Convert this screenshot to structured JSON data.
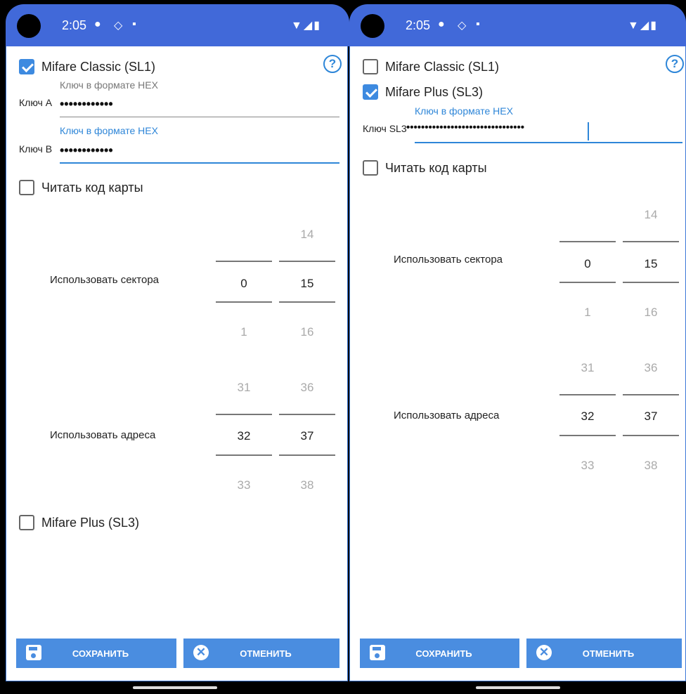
{
  "status_bar": {
    "time": "2:05"
  },
  "left": {
    "mifare_classic": {
      "label": "Mifare Classic (SL1)",
      "checked": true
    },
    "help_glyph": "?",
    "key_a": {
      "hint": "Ключ в формате HEX",
      "label": "Ключ A",
      "value": "••••••••••••"
    },
    "key_b": {
      "hint": "Ключ в формате HEX",
      "label": "Ключ B",
      "value": "••••••••••••"
    },
    "read_card_code": {
      "label": "Читать код карты",
      "checked": false
    },
    "sectors": {
      "label": "Использовать сектора",
      "col1": [
        "",
        "0",
        "1"
      ],
      "col2": [
        "14",
        "15",
        "16"
      ]
    },
    "addresses": {
      "label": "Использовать адреса",
      "col1": [
        "31",
        "32",
        "33"
      ],
      "col2": [
        "36",
        "37",
        "38"
      ]
    },
    "mifare_plus": {
      "label": "Mifare Plus (SL3)",
      "checked": false
    },
    "buttons": {
      "save": "СОХРАНИТЬ",
      "cancel": "ОТМЕНИТЬ"
    }
  },
  "right": {
    "mifare_classic": {
      "label": "Mifare Classic (SL1)",
      "checked": false
    },
    "help_glyph": "?",
    "mifare_plus": {
      "label": "Mifare Plus (SL3)",
      "checked": true
    },
    "key_sl3": {
      "hint": "Ключ в формате HEX",
      "label": "Ключ SL3",
      "value": "••••••••••••••••••••••••••••••••"
    },
    "read_card_code": {
      "label": "Читать код карты",
      "checked": false
    },
    "sectors": {
      "label": "Использовать сектора",
      "col1": [
        "",
        "0",
        "1"
      ],
      "col2": [
        "14",
        "15",
        "16"
      ]
    },
    "addresses": {
      "label": "Использовать адреса",
      "col1": [
        "31",
        "32",
        "33"
      ],
      "col2": [
        "36",
        "37",
        "38"
      ]
    },
    "buttons": {
      "save": "СОХРАНИТЬ",
      "cancel": "ОТМЕНИТЬ"
    }
  },
  "colors": {
    "accent": "#2e86d8",
    "status_bar": "#4169d9",
    "button": "#4a8de0"
  },
  "icons": [
    "help-icon",
    "save-icon",
    "cancel-icon",
    "wifi-icon",
    "signal-icon",
    "battery-icon",
    "shield-icon",
    "sd-card-icon"
  ]
}
